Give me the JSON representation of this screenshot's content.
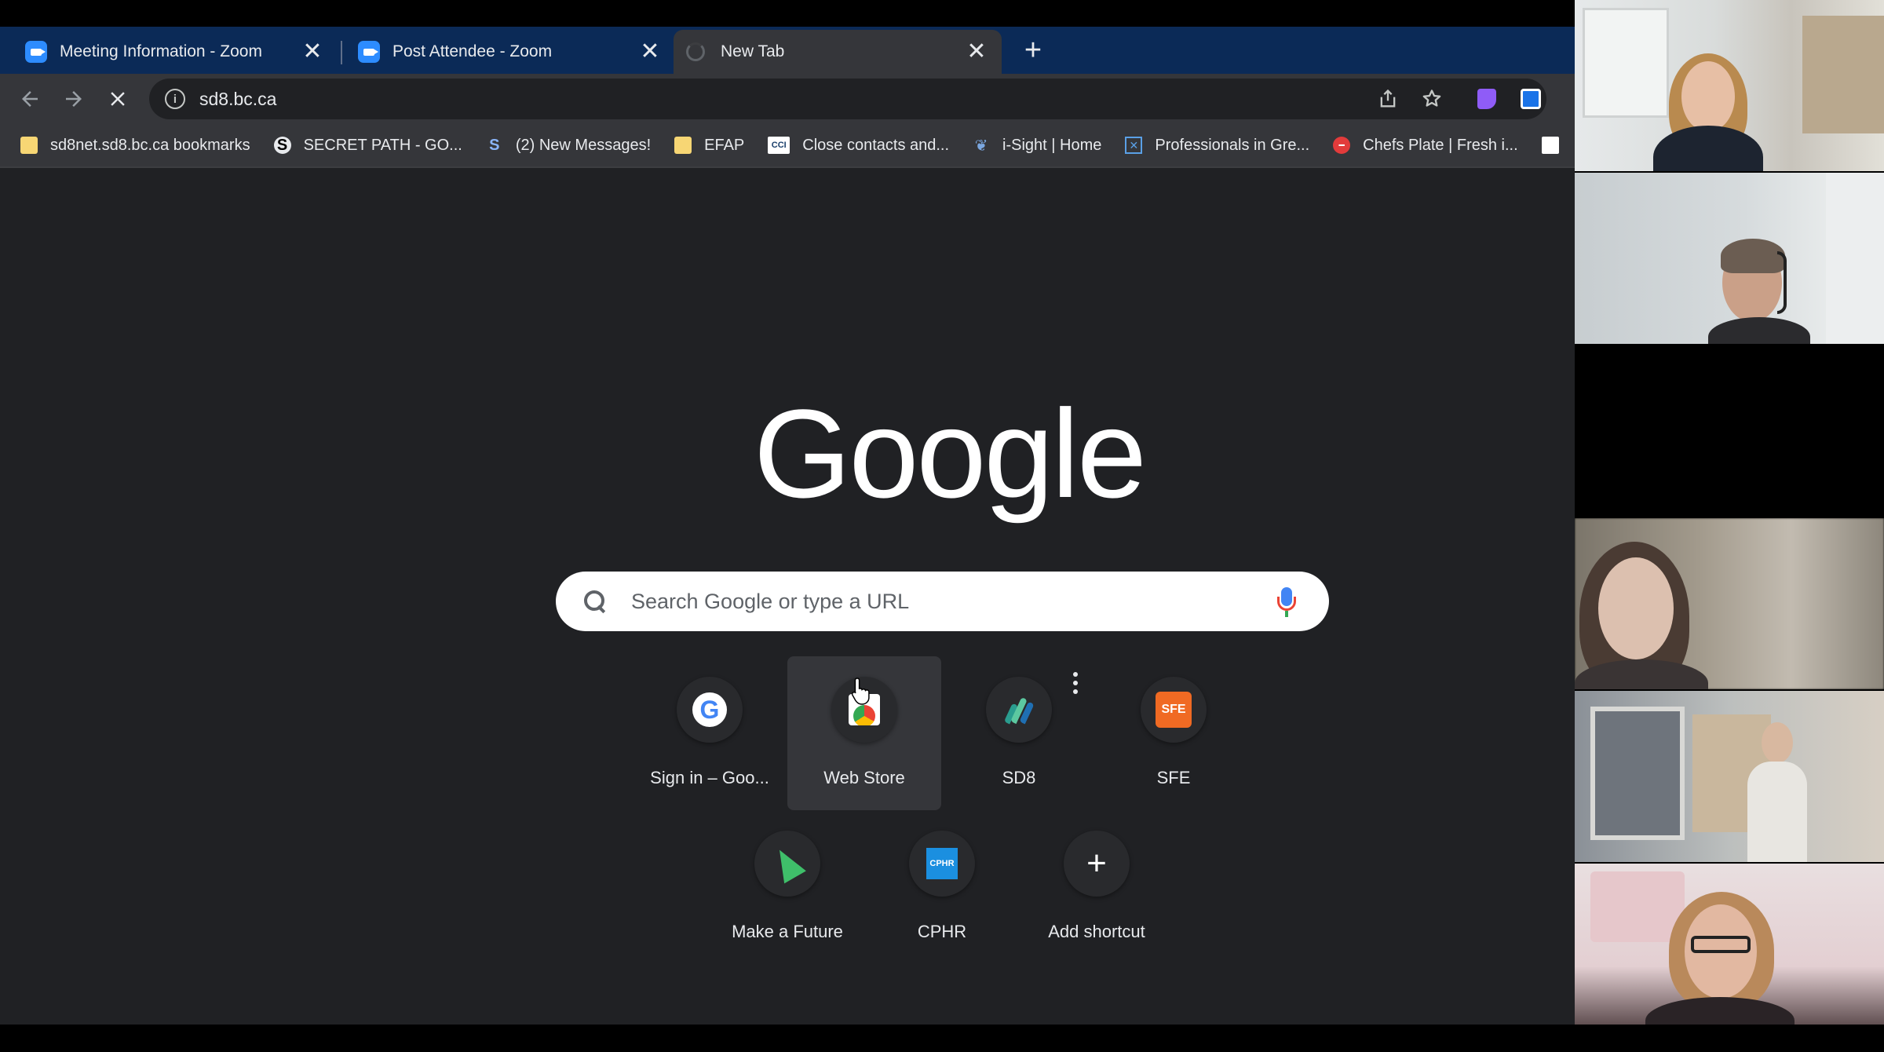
{
  "browser": {
    "tabs": [
      {
        "title": "Meeting Information - Zoom",
        "favicon": "zoom-icon",
        "active": false
      },
      {
        "title": "Post Attendee - Zoom",
        "favicon": "zoom-icon",
        "active": false
      },
      {
        "title": "New Tab",
        "favicon": "loading-spinner",
        "active": true
      }
    ],
    "new_tab_symbol": "+",
    "close_symbol": "✕",
    "address": "sd8.bc.ca",
    "bookmarks": [
      {
        "label": "sd8net.sd8.bc.ca bookmarks",
        "icon": "folder-icon"
      },
      {
        "label": "SECRET PATH - GO...",
        "icon": "secret-path-icon"
      },
      {
        "label": "(2) New Messages!",
        "icon": "messages-icon"
      },
      {
        "label": "EFAP",
        "icon": "folder-icon"
      },
      {
        "label": "Close contacts and...",
        "icon": "close-contacts-icon"
      },
      {
        "label": "i-Sight | Home",
        "icon": "isight-icon"
      },
      {
        "label": "Professionals in Gre...",
        "icon": "professionals-icon"
      },
      {
        "label": "Chefs Plate | Fresh i...",
        "icon": "chefs-plate-icon"
      }
    ]
  },
  "ntp": {
    "logo_text": "Google",
    "search_placeholder": "Search Google or type a URL",
    "shortcuts": [
      {
        "label": "Sign in – Goo...",
        "icon": "google-icon"
      },
      {
        "label": "Web Store",
        "icon": "webstore-icon"
      },
      {
        "label": "SD8",
        "icon": "sd8-icon"
      },
      {
        "label": "SFE",
        "icon": "sfe-icon",
        "icon_text": "SFE"
      },
      {
        "label": "Make a Future",
        "icon": "make-a-future-icon"
      },
      {
        "label": "CPHR",
        "icon": "cphr-icon",
        "icon_text": "CPHR"
      },
      {
        "label": "Add shortcut",
        "icon": "plus-icon"
      }
    ]
  },
  "zoom_participants": [
    {
      "tile": "participant-1"
    },
    {
      "tile": "participant-2"
    },
    {
      "tile": "participant-3"
    },
    {
      "tile": "participant-4"
    },
    {
      "tile": "participant-5"
    }
  ],
  "colors": {
    "tabstrip": "#0b2a57",
    "toolbar": "#35363a",
    "page_bg": "#202124",
    "zoom_blue": "#2d8cff"
  }
}
